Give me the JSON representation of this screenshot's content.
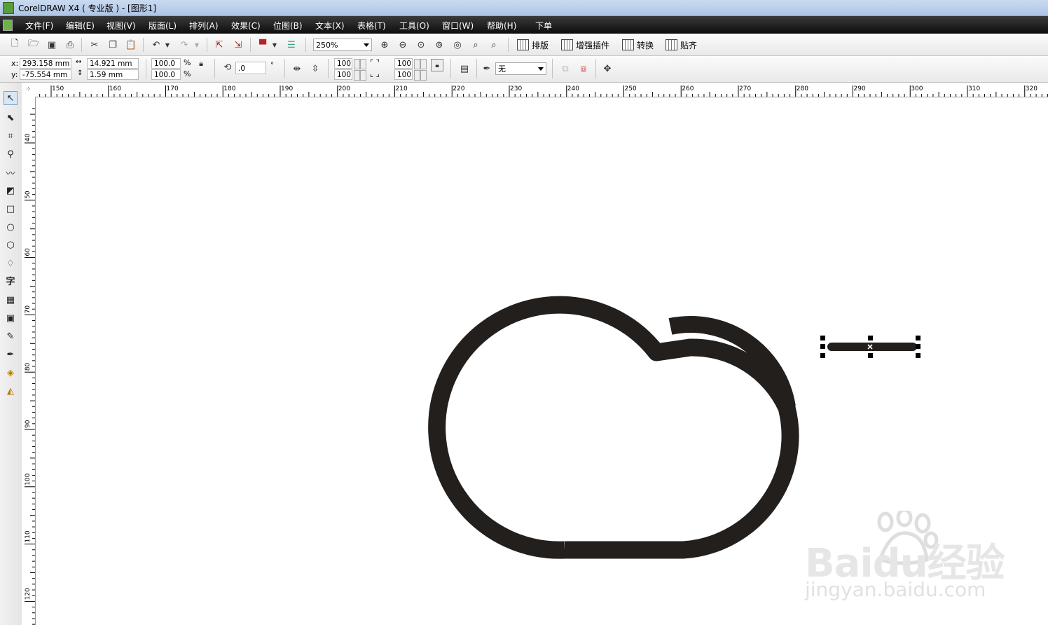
{
  "window": {
    "title": "CorelDRAW X4 ( 专业版 ) - [图形1]"
  },
  "menu": [
    "文件(F)",
    "编辑(E)",
    "视图(V)",
    "版面(L)",
    "排列(A)",
    "效果(C)",
    "位图(B)",
    "文本(X)",
    "表格(T)",
    "工具(O)",
    "窗口(W)",
    "帮助(H)",
    "下单"
  ],
  "toolbar": {
    "zoom": "250%",
    "plugin_buttons": [
      "排版",
      "增强插件",
      "转换",
      "贴齐"
    ]
  },
  "property_bar": {
    "x_label": "x:",
    "x_value": "293.158 mm",
    "y_label": "y:",
    "y_value": "-75.554 mm",
    "width_value": "14.921 mm",
    "height_value": "1.59 mm",
    "scale_x": "100.0",
    "scale_y": "100.0",
    "percent": "%",
    "rotation": ".0",
    "degree": "°",
    "pos1_a": "100",
    "pos1_b": "100",
    "pos2_a": "100",
    "pos2_b": "100",
    "outline": "无"
  },
  "rulers": {
    "top_labels": [
      "150",
      "160",
      "170",
      "180",
      "190",
      "200",
      "210",
      "220",
      "230",
      "240",
      "250",
      "260",
      "270",
      "280",
      "290",
      "300",
      "310",
      "320"
    ],
    "left_labels": [
      "40",
      "50",
      "60",
      "70",
      "80",
      "90",
      "100",
      "110",
      "120"
    ]
  },
  "watermark": {
    "brand": "Baidu经验",
    "url": "jingyan.baidu.com"
  },
  "colors": {
    "stroke": "#231f1c",
    "menubar": "#1a1a1a",
    "titlebar": "#b9cfeb"
  }
}
